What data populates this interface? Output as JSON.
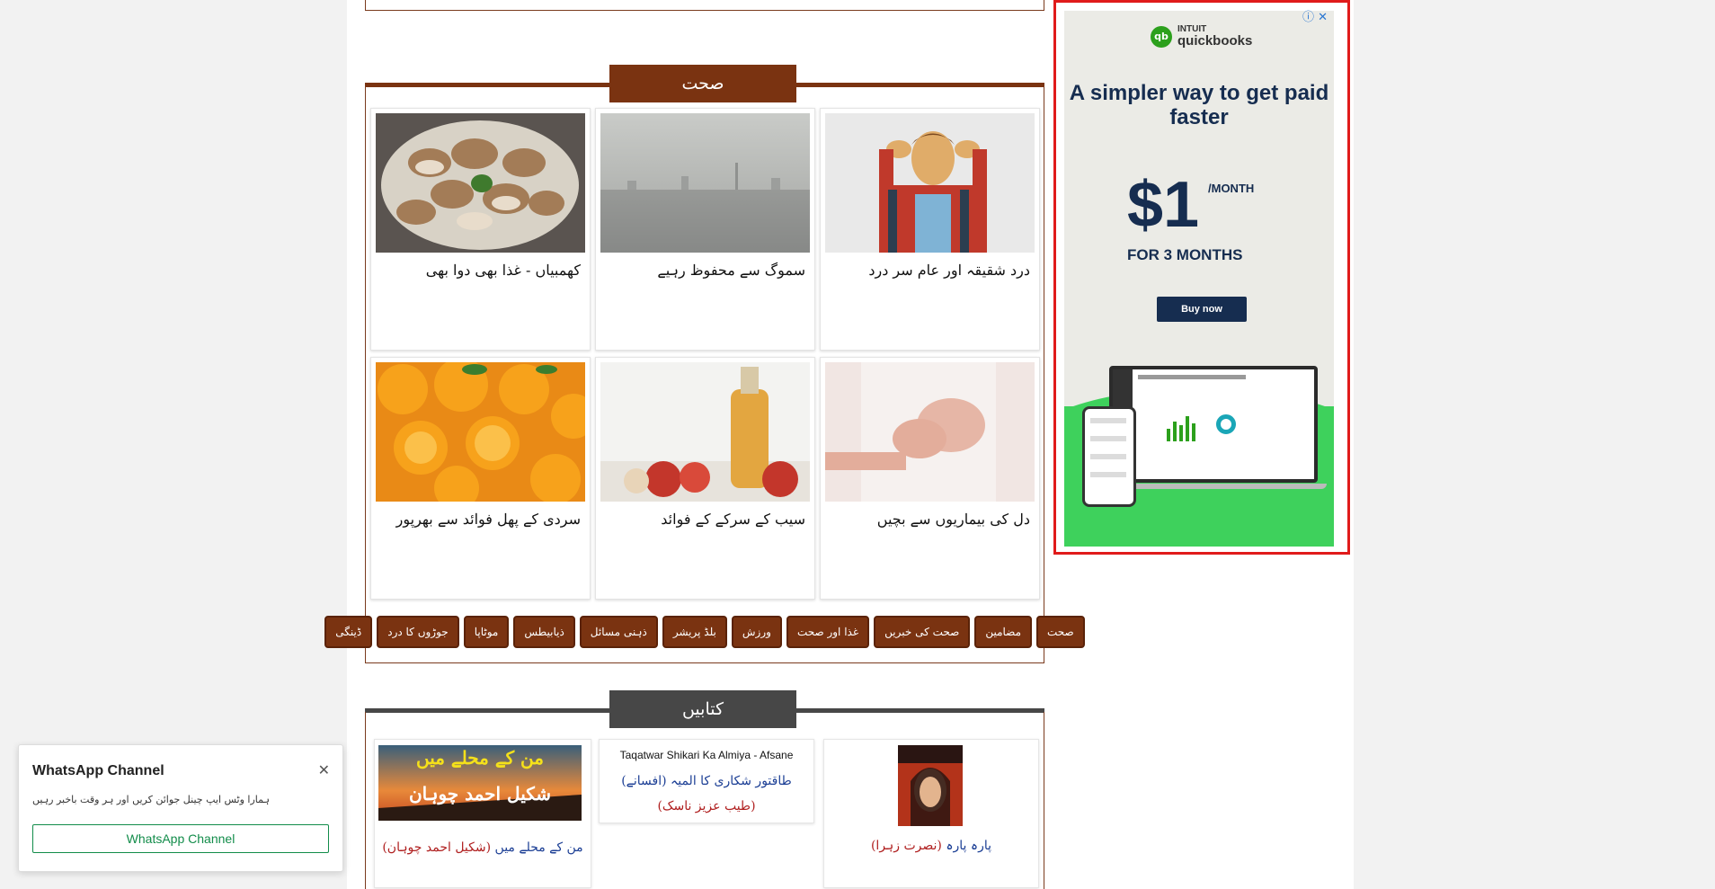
{
  "health": {
    "title": "صحت",
    "cards": [
      {
        "caption": "درد شقیقہ اور عام سر درد",
        "image": "man-with-headache-photo"
      },
      {
        "caption": "سموگ سے محفوظ رہیے",
        "image": "smog-city-photo"
      },
      {
        "caption": "کھمبیاں - غذا بھی دوا بھی",
        "image": "mushrooms-bowl-photo"
      },
      {
        "caption": "دل کی بیماریوں سے بچیں",
        "image": "chest-pain-photo"
      },
      {
        "caption": "سیب کے سرکے کے فوائد",
        "image": "apple-cider-vinegar-photo"
      },
      {
        "caption": "سردی کے پھل فوائد سے بھرپور",
        "image": "oranges-photo"
      }
    ],
    "tags": [
      "صحت",
      "مضامین",
      "صحت کی خبریں",
      "غذا اور صحت",
      "ورزش",
      "بلڈ پریشر",
      "ذہنی مسائل",
      "ذیابیطس",
      "موٹاپا",
      "جوڑوں کا درد",
      "ڈینگی"
    ]
  },
  "books": {
    "title": "کتابیں",
    "items": [
      {
        "title": "من کے محلے میں",
        "author": "(شکیل احمد چوہان)",
        "cover_text_1": "من کے محلے میں",
        "cover_text_2": "شکیل احمد چوہان"
      },
      {
        "latin_title": "Taqatwar Shikari Ka Almiya - Afsane",
        "title": "طاقتور شکاری کا المیہ (افسانے)",
        "author": "(طیب عزیز ناسک)"
      },
      {
        "title": "پارہ پارہ",
        "author": "(نصرت زہرا)"
      }
    ]
  },
  "ad": {
    "brand_line1": "INTUIT",
    "brand_line2": "quickbooks",
    "logo_mark": "qb",
    "headline": "A simpler way to get paid faster",
    "price": "$1",
    "per": "/MONTH",
    "duration": "FOR 3 MONTHS",
    "cta": "Buy now",
    "icons": "ⓘ ✕",
    "accent": "#162d50",
    "green": "#3ed15c"
  },
  "whatsapp": {
    "title": "WhatsApp Channel",
    "text": "ہمارا وٹس ایپ چینل جوائن کریں اور ہر وقت باخبر رہیں",
    "button": "WhatsApp Channel",
    "close": "✕"
  }
}
